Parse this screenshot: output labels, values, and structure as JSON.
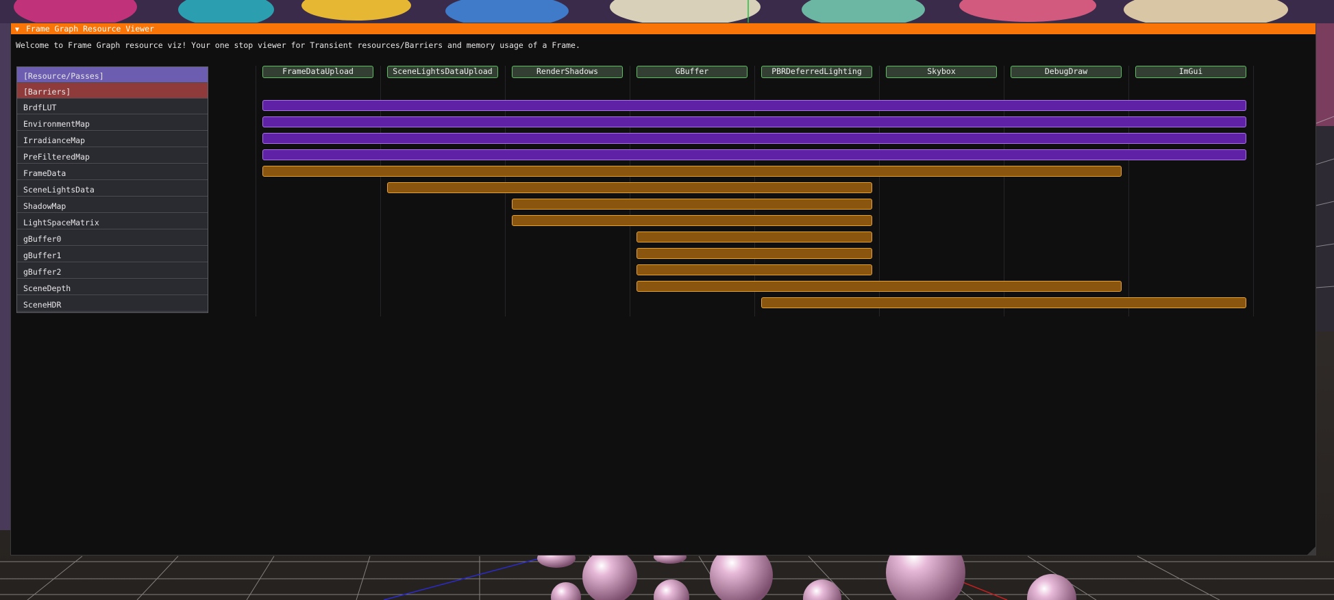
{
  "window": {
    "title": "Frame Graph Resource Viewer",
    "collapse_glyph": "▼",
    "welcome": "Welcome to Frame Graph resource viz! Your one stop viewer for Transient resources/Barriers and memory usage of a Frame."
  },
  "list": {
    "passes_header": "[Resource/Passes]",
    "barriers_header": "[Barriers]"
  },
  "colors": {
    "title_bar": "#fa7508",
    "passes_header": "#6c5db0",
    "barriers_header": "#8f3b3b",
    "persistent_bar": "#5f21a6",
    "transient_bar": "#8a550f",
    "pass_border": "#5fbf63"
  },
  "passes": [
    "FrameDataUpload",
    "SceneLightsDataUpload",
    "RenderShadows",
    "GBuffer",
    "PBRDeferredLighting",
    "Skybox",
    "DebugDraw",
    "ImGui"
  ],
  "resources": [
    {
      "name": "BrdfLUT",
      "first_pass": 0,
      "last_pass": 7,
      "kind": "persistent"
    },
    {
      "name": "EnvironmentMap",
      "first_pass": 0,
      "last_pass": 7,
      "kind": "persistent"
    },
    {
      "name": "IrradianceMap",
      "first_pass": 0,
      "last_pass": 7,
      "kind": "persistent"
    },
    {
      "name": "PreFilteredMap",
      "first_pass": 0,
      "last_pass": 7,
      "kind": "persistent"
    },
    {
      "name": "FrameData",
      "first_pass": 0,
      "last_pass": 6,
      "kind": "transient"
    },
    {
      "name": "SceneLightsData",
      "first_pass": 1,
      "last_pass": 4,
      "kind": "transient"
    },
    {
      "name": "ShadowMap",
      "first_pass": 2,
      "last_pass": 4,
      "kind": "transient"
    },
    {
      "name": "LightSpaceMatrix",
      "first_pass": 2,
      "last_pass": 4,
      "kind": "transient"
    },
    {
      "name": "gBuffer0",
      "first_pass": 3,
      "last_pass": 4,
      "kind": "transient"
    },
    {
      "name": "gBuffer1",
      "first_pass": 3,
      "last_pass": 4,
      "kind": "transient"
    },
    {
      "name": "gBuffer2",
      "first_pass": 3,
      "last_pass": 4,
      "kind": "transient"
    },
    {
      "name": "SceneDepth",
      "first_pass": 3,
      "last_pass": 6,
      "kind": "transient"
    },
    {
      "name": "SceneHDR",
      "first_pass": 4,
      "last_pass": 7,
      "kind": "transient"
    }
  ]
}
